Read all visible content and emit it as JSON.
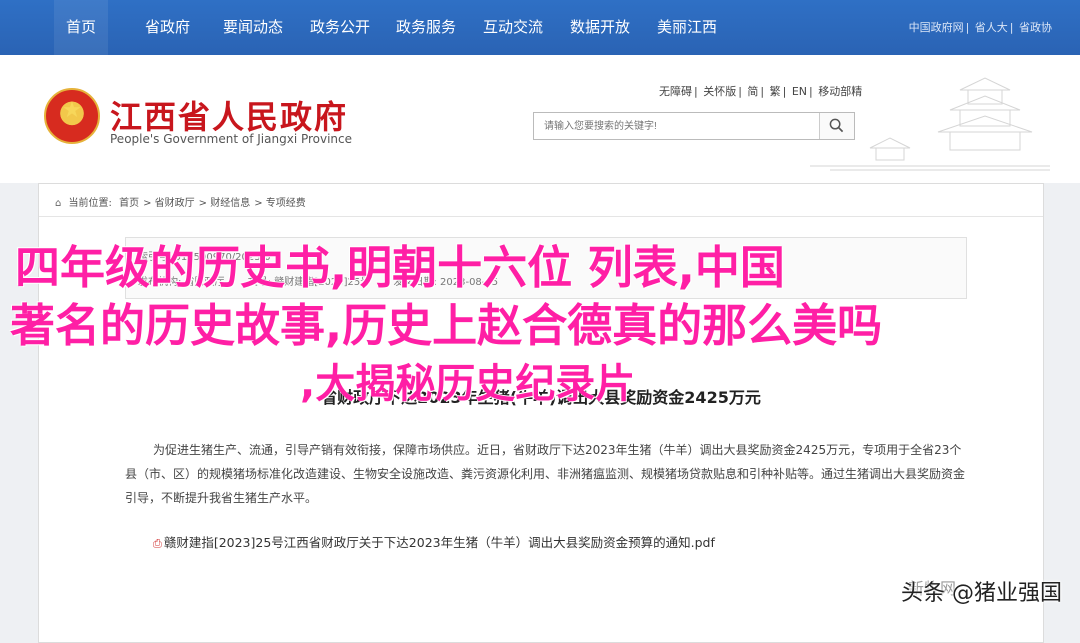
{
  "topnav": {
    "items": [
      "首页",
      "省政府",
      "要闻动态",
      "政务公开",
      "政务服务",
      "互动交流",
      "数据开放",
      "美丽江西"
    ],
    "right_links": [
      "中国政府网",
      "省人大",
      "省政协"
    ]
  },
  "header": {
    "title": "江西省人民政府",
    "subtitle_en": "People's Government of Jiangxi Province",
    "util_links": [
      "无障碍",
      "关怀版",
      "简",
      "繁",
      "EN",
      "移动部精"
    ],
    "search_placeholder": "请输入您要搜索的关键字!"
  },
  "breadcrumb": {
    "label": "当前位置:",
    "items": [
      "首页",
      "省财政厅",
      "财经信息",
      "专项经费"
    ]
  },
  "meta": {
    "row1": "索引号: 014500970/2023-0",
    "row2": [
      "发布机构: 省财政厅",
      "文号: 赣财建指[2023]25号",
      "发文日期: 2023-08-15"
    ]
  },
  "article": {
    "title": "省财政厅下达2023年生猪(牛羊)调出大县奖励资金2425万元",
    "paragraph": "为促进生猪生产、流通，引导产销有效衔接，保障市场供应。近日，省财政厅下达2023年生猪（牛羊）调出大县奖励资金2425万元，专项用于全省23个县（市、区）的规模猪场标准化改造建设、生物安全设施改造、粪污资源化利用、非洲猪瘟监测、规模猪场贷款贴息和引种补贴等。通过生猪调出大县奖励资金引导，不断提升我省生猪生产水平。",
    "attachment": "赣财建指[2023]25号江西省财政厅关于下达2023年生猪（牛羊）调出大县奖励资金预算的通知.pdf"
  },
  "overlay": {
    "line1": "四年级的历史书,明朝十六位  列表,中国",
    "line2": "著名的历史故事,历史上赵合德真的那么美吗",
    "line3": ",大揭秘历史纪录片"
  },
  "watermark": {
    "source_logo": "新牧网",
    "text": "头条 @猪业强国"
  }
}
